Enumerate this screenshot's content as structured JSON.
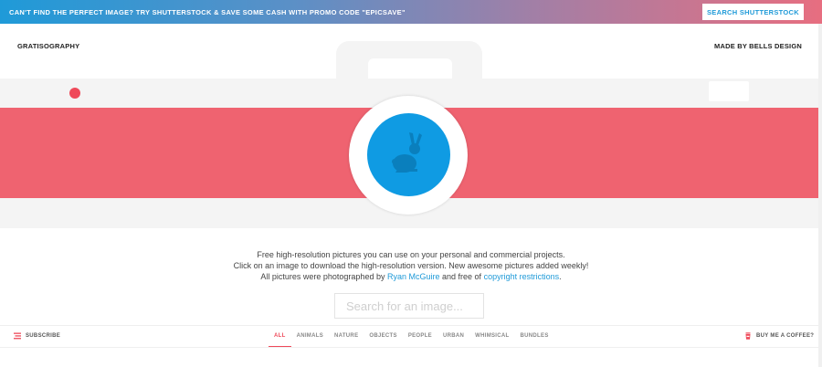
{
  "promo": {
    "text": "CAN'T FIND THE PERFECT IMAGE? TRY SHUTTERSTOCK & SAVE SOME CASH WITH PROMO CODE \"EPICSAVE\"",
    "button_label": "SEARCH SHUTTERSTOCK"
  },
  "header": {
    "logo": "GRATISOGRAPHY",
    "credit": "MADE BY BELLS DESIGN"
  },
  "intro": {
    "line1": "Free high-resolution pictures you can use on your personal and commercial projects.",
    "line2": "Click on an image to download the high-resolution version. New awesome pictures added weekly!",
    "line3_prefix": "All pictures were photographed by",
    "author_link": "Ryan McGuire",
    "line3_middle": "and free of",
    "license_link": "copyright restrictions",
    "line3_suffix": "."
  },
  "search": {
    "placeholder": "Search for an image..."
  },
  "nav": {
    "subscribe_label": "SUBSCRIBE",
    "coffee_label": "BUY ME A COFFEE?",
    "categories": [
      "ALL",
      "ANIMALS",
      "NATURE",
      "OBJECTS",
      "PEOPLE",
      "URBAN",
      "WHIMSICAL",
      "BUNDLES"
    ],
    "active_category": "ALL"
  },
  "icons": {
    "camera_lens": "rabbit-icon",
    "subscribe": "list-icon",
    "coffee": "coffee-cup-icon"
  },
  "colors": {
    "accent_blue": "#1f9ad8",
    "accent_red": "#ef6370",
    "lens_blue": "#0f9be3"
  }
}
